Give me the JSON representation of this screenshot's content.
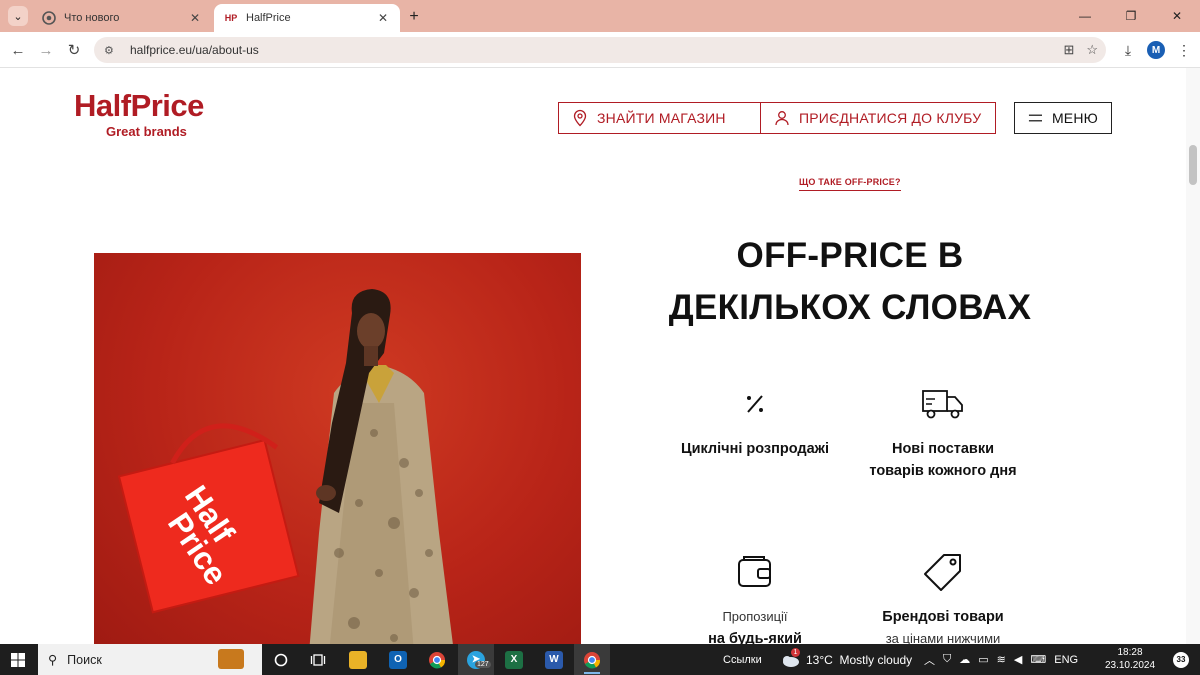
{
  "browser": {
    "tabs": [
      {
        "title": "Что нового",
        "active": false
      },
      {
        "title": "HalfPrice",
        "active": true,
        "favicon_text": "HP"
      }
    ],
    "url": "halfprice.eu/ua/about-us",
    "profile_initial": "M"
  },
  "header": {
    "logo_brand": "HalfPrice",
    "logo_tagline": "Great brands",
    "find_store_label": "ЗНАЙТИ МАГАЗИН",
    "join_club_label": "ПРИЄДНАТИСЯ ДО КЛУБУ",
    "menu_label": "МЕНЮ"
  },
  "subnav": {
    "link_label": "ЩО ТАКЕ OFF-PRICE?"
  },
  "hero": {
    "bag_text_line1": "Half",
    "bag_text_line2": "Price"
  },
  "section": {
    "headline_line1": "OFF-PRICE В",
    "headline_line2": "ДЕКІЛЬКОХ СЛОВАХ"
  },
  "features": [
    {
      "icon": "percent-icon",
      "title": "Циклічні розпродажі"
    },
    {
      "icon": "truck-icon",
      "title_line1": "Нові поставки",
      "title_line2": "товарів кожного дня"
    },
    {
      "icon": "wallet-icon",
      "subtitle": "Пропозиції",
      "title": "на будь-який"
    },
    {
      "icon": "tag-icon",
      "title": "Брендові товари",
      "subtitle": "за цінами нижчими"
    }
  ],
  "taskbar": {
    "search_placeholder": "Поиск",
    "links_label": "Ссылки",
    "weather": "13°C  Mostly cloudy",
    "language": "ENG",
    "time": "18:28",
    "date": "23.10.2024",
    "telegram_badge": "127",
    "notifications_count": "33",
    "weather_badge": "1"
  },
  "colors": {
    "brand_red": "#b01c24",
    "tab_strip": "#e8b4a6",
    "taskbar": "#1e1e1e"
  }
}
